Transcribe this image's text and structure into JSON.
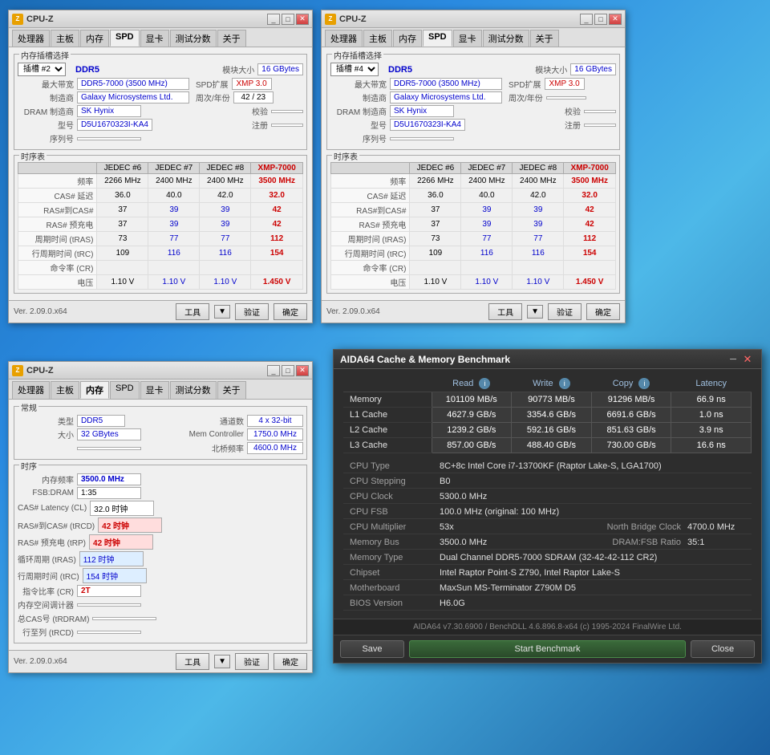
{
  "desktop": {
    "background": "blue gradient"
  },
  "cpuz_window1": {
    "title": "CPU-Z",
    "slot": "#2",
    "type": "DDR5",
    "module_size_label": "模块大小",
    "module_size": "16 GBytes",
    "max_bandwidth_label": "最大带宽",
    "max_bandwidth": "DDR5-7000 (3500 MHz)",
    "spd_ext_label": "SPD扩展",
    "spd_ext": "XMP 3.0",
    "manufacturer_label": "制造商",
    "manufacturer": "Galaxy Microsystems Ltd.",
    "weeks_label": "周次/年份",
    "weeks": "42 / 23",
    "dram_mfr_label": "DRAM 制造商",
    "dram_mfr": "SK Hynix",
    "verify_label": "校验",
    "model_label": "型号",
    "model": "D5U1670323I-KA4",
    "serial_label": "序列号",
    "note_label": "注册",
    "timing_group_label": "时序表",
    "jedec6": "JEDEC #6",
    "jedec7": "JEDEC #7",
    "jedec8": "JEDEC #8",
    "xmp7000": "XMP-7000",
    "freq_label": "频率",
    "freq_j6": "2266 MHz",
    "freq_j7": "2400 MHz",
    "freq_j8": "2400 MHz",
    "freq_xmp": "3500 MHz",
    "cas_label": "CAS# 延迟",
    "cas_j6": "36.0",
    "cas_j7": "40.0",
    "cas_j8": "42.0",
    "cas_xmp": "32.0",
    "rascas_label": "RAS#到CAS#",
    "rascas_j6": "37",
    "rascas_j7": "39",
    "rascas_j8": "39",
    "rascas_xmp": "42",
    "raspc_label": "RAS# 预充电",
    "raspc_j6": "37",
    "raspc_j7": "39",
    "raspc_j8": "39",
    "raspc_xmp": "42",
    "cycle_label": "周期时间 (tRAS)",
    "cycle_j6": "73",
    "cycle_j7": "77",
    "cycle_j8": "77",
    "cycle_xmp": "112",
    "row_label": "行周期时间 (tRC)",
    "row_j6": "109",
    "row_j7": "116",
    "row_j8": "116",
    "row_xmp": "154",
    "cmd_label": "命令率 (CR)",
    "voltage_label": "电压",
    "voltage_j6": "1.10 V",
    "voltage_j7": "1.10 V",
    "voltage_j8": "1.10 V",
    "voltage_xmp": "1.450 V",
    "version": "Ver. 2.09.0.x64",
    "tools_btn": "工具",
    "verify_btn": "验证",
    "ok_btn": "确定"
  },
  "cpuz_window2": {
    "title": "CPU-Z",
    "slot": "#4",
    "type": "DDR5",
    "module_size": "16 GBytes",
    "max_bandwidth": "DDR5-7000 (3500 MHz)",
    "spd_ext": "XMP 3.0",
    "manufacturer": "Galaxy Microsystems Ltd.",
    "weeks": "",
    "dram_mfr": "SK Hynix",
    "model": "D5U1670323I-KA4",
    "freq_j6": "2266 MHz",
    "freq_j7": "2400 MHz",
    "freq_j8": "2400 MHz",
    "freq_xmp": "3500 MHz",
    "cas_j6": "36.0",
    "cas_j7": "40.0",
    "cas_j8": "42.0",
    "cas_xmp": "32.0",
    "rascas_j6": "37",
    "rascas_j7": "39",
    "rascas_j8": "39",
    "rascas_xmp": "42",
    "raspc_j6": "37",
    "raspc_j7": "39",
    "raspc_j8": "39",
    "raspc_xmp": "42",
    "cycle_j6": "73",
    "cycle_j7": "77",
    "cycle_j8": "77",
    "cycle_xmp": "112",
    "row_j6": "109",
    "row_j7": "116",
    "row_j8": "116",
    "row_xmp": "154",
    "voltage_j6": "1.10 V",
    "voltage_j7": "1.10 V",
    "voltage_j8": "1.10 V",
    "voltage_xmp": "1.450 V",
    "version": "Ver. 2.09.0.x64",
    "tools_btn": "工具",
    "verify_btn": "验证",
    "ok_btn": "确定"
  },
  "cpuz_window3": {
    "title": "CPU-Z",
    "mem_group_label": "常规",
    "type_label": "类型",
    "type": "DDR5",
    "channels_label": "通道数",
    "channels": "4 x 32-bit",
    "size_label": "大小",
    "size": "32 GBytes",
    "mem_controller_label": "Mem Controller",
    "mem_controller": "1750.0 MHz",
    "nb_freq_label": "北桥频率",
    "nb_freq": "4600.0 MHz",
    "timing_group_label": "时序",
    "mem_freq_label": "内存频率",
    "mem_freq": "3500.0 MHz",
    "fsb_label": "FSB:DRAM",
    "fsb": "1:35",
    "cas_label": "CAS# Latency (CL)",
    "cas": "32.0 时钟",
    "rcd_label": "RAS#到CAS# (tRCD)",
    "rcd": "42 时钟",
    "rp_label": "RAS# 预充电 (tRP)",
    "rp": "42 时钟",
    "tras_label": "循环周期 (tRAS)",
    "tras": "112 时钟",
    "trc_label": "行周期时间 (tRC)",
    "trc": "154 时钟",
    "cr_label": "指令比率 (CR)",
    "cr": "2T",
    "unused1_label": "内存空间调计器",
    "unused2_label": "总CAS号 (tRDRAM)",
    "unused3_label": "行至列 (tRCD)",
    "version": "Ver. 2.09.0.x64",
    "tools_btn": "工具",
    "verify_btn": "验证",
    "ok_btn": "确定",
    "tabs": [
      "处理器",
      "主板",
      "内存",
      "SPD",
      "显卡",
      "测试分数",
      "关于"
    ]
  },
  "aida64": {
    "title": "AIDA64 Cache & Memory Benchmark",
    "col_read": "Read",
    "col_write": "Write",
    "col_copy": "Copy",
    "col_latency": "Latency",
    "row_memory": "Memory",
    "row_l1": "L1 Cache",
    "row_l2": "L2 Cache",
    "row_l3": "L3 Cache",
    "mem_read": "101109 MB/s",
    "mem_write": "90773 MB/s",
    "mem_copy": "91296 MB/s",
    "mem_latency": "66.9 ns",
    "l1_read": "4627.9 GB/s",
    "l1_write": "3354.6 GB/s",
    "l1_copy": "6691.6 GB/s",
    "l1_latency": "1.0 ns",
    "l2_read": "1239.2 GB/s",
    "l2_write": "592.16 GB/s",
    "l2_copy": "851.63 GB/s",
    "l2_latency": "3.9 ns",
    "l3_read": "857.00 GB/s",
    "l3_write": "488.40 GB/s",
    "l3_copy": "730.00 GB/s",
    "l3_latency": "16.6 ns",
    "cpu_type_label": "CPU Type",
    "cpu_type": "8C+8c Intel Core i7-13700KF  (Raptor Lake-S, LGA1700)",
    "cpu_stepping_label": "CPU Stepping",
    "cpu_stepping": "B0",
    "cpu_clock_label": "CPU Clock",
    "cpu_clock": "5300.0 MHz",
    "cpu_fsb_label": "CPU FSB",
    "cpu_fsb": "100.0 MHz  (original: 100 MHz)",
    "cpu_mult_label": "CPU Multiplier",
    "cpu_mult": "53x",
    "nb_clock_label": "North Bridge Clock",
    "nb_clock": "4700.0 MHz",
    "mem_bus_label": "Memory Bus",
    "mem_bus": "3500.0 MHz",
    "dram_fsb_label": "DRAM:FSB Ratio",
    "dram_fsb": "35:1",
    "mem_type_label": "Memory Type",
    "mem_type": "Dual Channel DDR5-7000 SDRAM  (32-42-42-112 CR2)",
    "chipset_label": "Chipset",
    "chipset": "Intel Raptor Point-S Z790, Intel Raptor Lake-S",
    "motherboard_label": "Motherboard",
    "motherboard": "MaxSun MS-Terminator Z790M D5",
    "bios_label": "BIOS Version",
    "bios": "H6.0G",
    "footer": "AIDA64 v7.30.6900 / BenchDLL 4.6.896.8-x64  (c) 1995-2024 FinalWire Ltd.",
    "save_btn": "Save",
    "benchmark_btn": "Start Benchmark",
    "close_btn": "Close"
  }
}
